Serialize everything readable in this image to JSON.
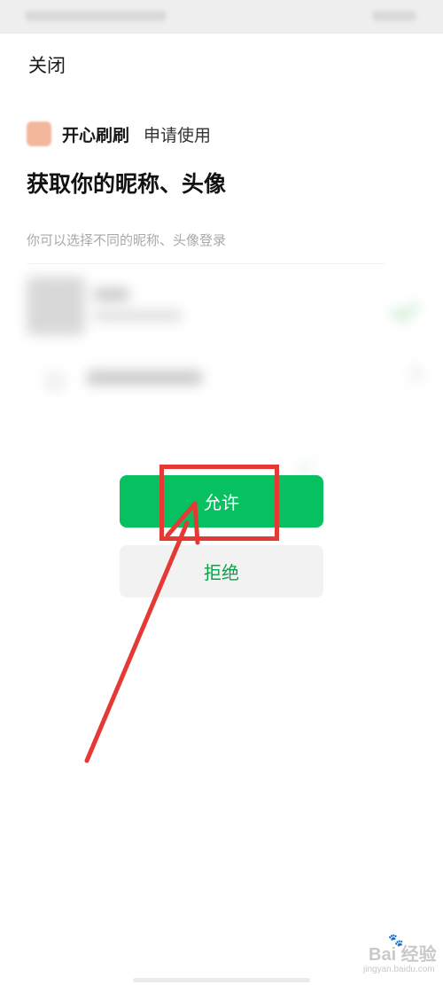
{
  "header": {
    "close_label": "关闭"
  },
  "app": {
    "name": "开心刷刷",
    "request_text": "申请使用"
  },
  "auth": {
    "title": "获取你的昵称、头像",
    "description": "你可以选择不同的昵称、头像登录"
  },
  "actions": {
    "allow_label": "允许",
    "deny_label": "拒绝"
  },
  "watermark": {
    "logo_text": "Bai 经验",
    "url_text": "jingyan.baidu.com"
  },
  "colors": {
    "accent_green": "#07c160",
    "deny_text_green": "#07a34a",
    "annotation_red": "#e53935",
    "app_icon": "#f3b79c"
  },
  "icons": {
    "app_icon": "app-logo-icon",
    "selected": "checkmark-icon",
    "other_profile": "radio-icon",
    "chevron": "chevron-right-icon",
    "watermark_paw": "paw-icon"
  }
}
